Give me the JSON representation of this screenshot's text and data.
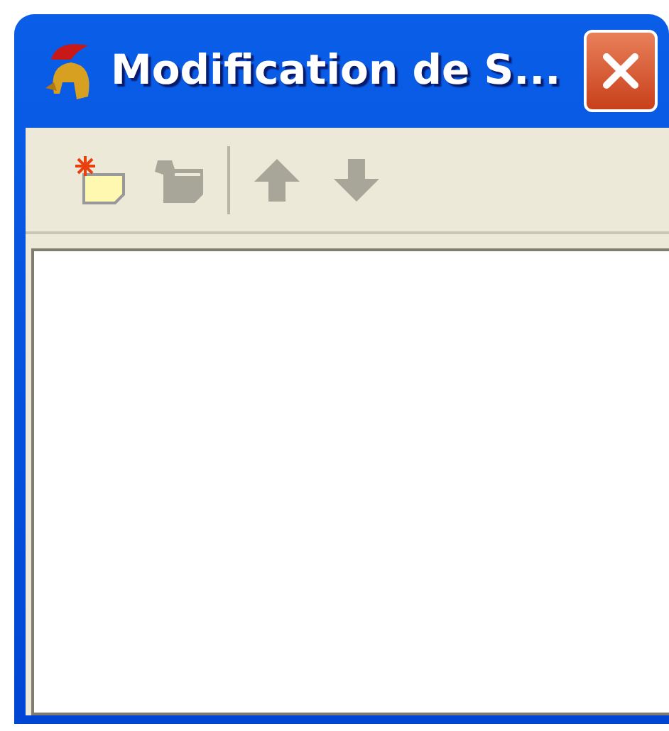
{
  "window": {
    "title": "Modification de S..."
  },
  "toolbar": [
    {
      "kind": "new",
      "disabled": false
    },
    {
      "kind": "delete",
      "disabled": true
    },
    {
      "kind": "separator"
    },
    {
      "kind": "up",
      "disabled": true
    },
    {
      "kind": "down",
      "disabled": true
    }
  ]
}
